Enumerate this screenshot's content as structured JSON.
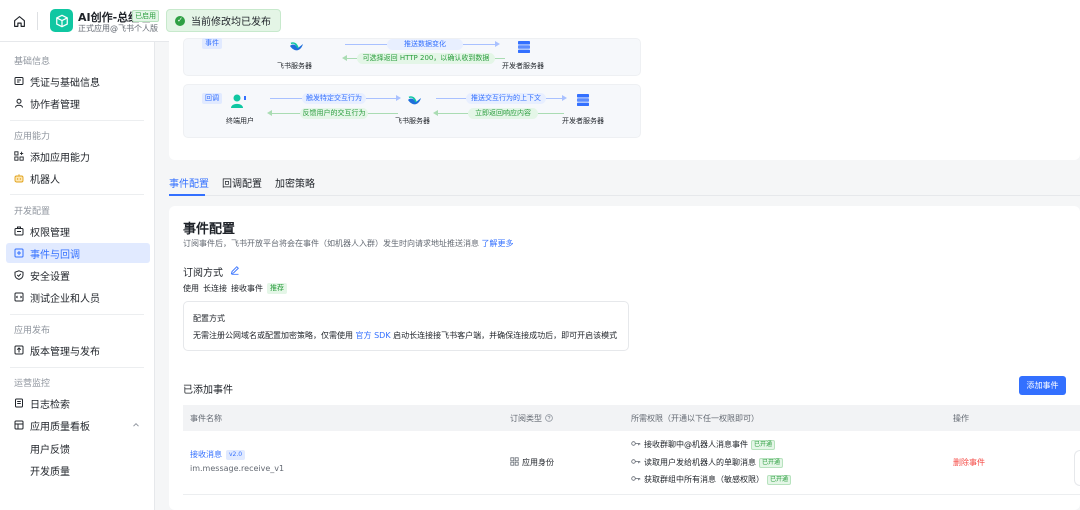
{
  "app": {
    "name": "AI创作-总经理",
    "status_badge": "已启用",
    "subtitle": "正式应用@飞书个人版"
  },
  "toast": {
    "message": "当前修改均已发布"
  },
  "sidebar": {
    "groups": [
      {
        "label": "基础信息",
        "items": [
          {
            "label": "凭证与基础信息",
            "icon": "credential-icon"
          },
          {
            "label": "协作者管理",
            "icon": "user-icon"
          }
        ]
      },
      {
        "label": "应用能力",
        "items": [
          {
            "label": "添加应用能力",
            "icon": "grid-add-icon"
          },
          {
            "label": "机器人",
            "icon": "robot-icon"
          }
        ]
      },
      {
        "label": "开发配置",
        "items": [
          {
            "label": "权限管理",
            "icon": "permission-icon"
          },
          {
            "label": "事件与回调",
            "icon": "event-icon",
            "active": true
          },
          {
            "label": "安全设置",
            "icon": "shield-icon"
          },
          {
            "label": "测试企业和人员",
            "icon": "test-icon"
          }
        ]
      },
      {
        "label": "应用发布",
        "items": [
          {
            "label": "版本管理与发布",
            "icon": "publish-icon"
          }
        ]
      },
      {
        "label": "运营监控",
        "items": [
          {
            "label": "日志检索",
            "icon": "log-icon"
          },
          {
            "label": "应用质量看板",
            "icon": "dashboard-icon",
            "expanded": true
          }
        ]
      }
    ],
    "sub_items": [
      "用户反馈",
      "开发质量"
    ]
  },
  "diagram": {
    "event": {
      "tag": "事件",
      "left_node": "飞书服务器",
      "right_node": "开发者服务器",
      "top_arrow": "推送数据变化",
      "bottom_arrow": "可选择返回 HTTP 200，以确认收到数据"
    },
    "callback": {
      "tag": "回调",
      "user_node": "终端用户",
      "mid_node": "飞书服务器",
      "right_node": "开发者服务器",
      "arrow1_top": "触发特定交互行为",
      "arrow1_bottom": "反馈用户的交互行为",
      "arrow2_top": "推送交互行为的上下文",
      "arrow2_bottom": "立即返回响应内容"
    }
  },
  "tabs": [
    "事件配置",
    "回调配置",
    "加密策略"
  ],
  "event_config": {
    "title": "事件配置",
    "description": "订阅事件后，飞书开放平台将会在事件（如机器人入群）发生时向请求地址推送消息",
    "learn_more": "了解更多",
    "subscribe_label": "订阅方式",
    "method_prefix": "使用",
    "method_main": "长连接",
    "method_suffix": "接收事件",
    "recommended": "推荐",
    "config_title": "配置方式",
    "config_desc_before": "无需注册公网域名或配置加密策略，仅需使用",
    "config_link": "官方 SDK",
    "config_desc_after": "启动长连接接飞书客户端，并确保连接成功后，即可开启该模式"
  },
  "events_table": {
    "title": "已添加事件",
    "add_button": "添加事件",
    "columns": [
      "事件名称",
      "订阅类型",
      "所需权限（开通以下任一权限即可）",
      "操作"
    ],
    "rows": [
      {
        "name": "接收消息",
        "version": "v2.0",
        "code": "im.message.receive_v1",
        "sub_type": "应用身份",
        "permissions": [
          {
            "label": "接收群聊中@机器人消息事件",
            "status": "已开通"
          },
          {
            "label": "读取用户发给机器人的单聊消息",
            "status": "已开通"
          },
          {
            "label": "获取群组中所有消息（敏感权限）",
            "status": "已开通"
          }
        ],
        "action": "删除事件"
      }
    ]
  },
  "colors": {
    "accent": "#3370ff",
    "success": "#2a9d3d",
    "danger": "#f54a45",
    "brand": "#10c7a2"
  }
}
